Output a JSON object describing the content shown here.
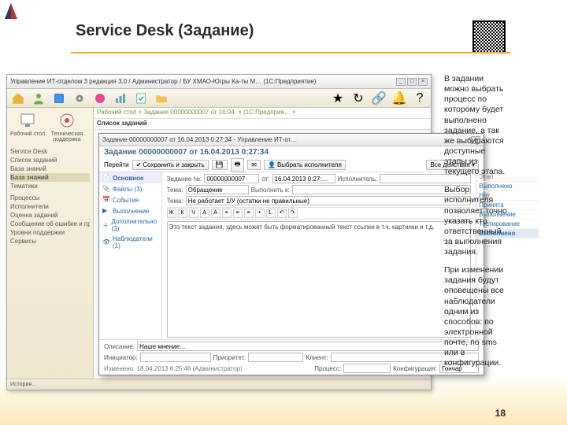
{
  "slide": {
    "title": "Service Desk (Задание)",
    "page_number": "18"
  },
  "right_text": {
    "p1": "В задании можно выбрать процесс по которому будет выполнено задание, а так же выбираются доступные этапы из текущего этапа.",
    "p2": "Выбор исполнителя позволяет точно указать кто ответственный за выполнения задания.",
    "p3": "При изменении задания будут оповещены все наблюдатели одним из способов: по электронной почте, по sms или в конфигурации."
  },
  "app": {
    "window_title": "Управление ИТ-отделом 3 редакция 3.0 / Администратор / БУ ХМАО-Югры Ка-ты М… (1С:Предприятие)",
    "statusbar_left": "История…",
    "sidebar": {
      "big": [
        {
          "label": "Рабочий стол"
        },
        {
          "label": "Техническая поддержка"
        }
      ],
      "items": [
        "Service Desk",
        "Список заданий",
        "База знаний",
        "База знаний",
        "Тематики",
        "Процессы",
        "Исполнители",
        "Оценка заданий",
        "Сообщение об ошибке и пр…",
        "Уровни поддержки",
        "Сервисы"
      ],
      "selected_index": 3
    },
    "main": {
      "breadcrumb": "Рабочий стол  ×  Задание 00000000007 от 16.04.  ×  (1С:Предприя…  ×",
      "list_title": "Список заданий"
    }
  },
  "task": {
    "window_title": "Задание 00000000007 от 16.04.2013 0:27:34 - Управление ИТ-от…",
    "header": "Задание 00000000007 от 16.04.2013 0:27:34",
    "toolbar": {
      "go": "Перейти",
      "save_close": "Сохранить и закрыть",
      "save_icon": "💾",
      "assign": "Выбрать исполнителя",
      "all_actions": "Все действия ▾"
    },
    "tabs": [
      {
        "label": "Основное",
        "icon": "doc"
      },
      {
        "label": "Файлы (3)",
        "icon": "clip"
      },
      {
        "label": "События",
        "icon": "cal"
      },
      {
        "label": "Выполнение",
        "icon": "run"
      },
      {
        "label": "Дополнительно (3)",
        "icon": "plus"
      },
      {
        "label": "Наблюдатели (1)",
        "icon": "eye"
      }
    ],
    "selected_tab": 0,
    "fields": {
      "number_label": "Задание №:",
      "number": "00000000007",
      "date_label": "от:",
      "date": "16.04.2013 0:27:…",
      "executor_label": "Исполнитель:",
      "executor": "",
      "theme_label": "Тема:",
      "theme": "Обращение",
      "process_label": "Выполнить к:",
      "process": "",
      "subject_label": "Тема:",
      "subject": "Не работает 1/У (остатки не правильные)"
    },
    "rte": {
      "format_btns": [
        "Ж",
        "К",
        "Ч",
        "A",
        "A",
        "≡",
        "≡",
        "≡",
        "•",
        "1.",
        "↶",
        "↷"
      ],
      "body_html": "Это текст задания, здесь может быть форматированный текст ссылки в т.ч. картинки и т.д."
    },
    "right_panel": {
      "header": "Этап",
      "stages": [
        "Выполнено",
        "Нет",
        "Принята",
        "Выполнение",
        "Тестирование",
        "Выполнено"
      ],
      "selected": 5
    },
    "bottom": {
      "description_label": "Описание:",
      "description": "Наше мнение…",
      "initiator_label": "Инициатор:",
      "initiator": "",
      "priority_label": "Приоритет:",
      "priority": "",
      "client_label": "Клиент:",
      "client": "",
      "last_edit": "Изменено: 18.04.2013 6:25:46 (Администратор)",
      "process_field_label": "Процесс:",
      "process_field": "",
      "cfg_label": "Конфигурация:",
      "cfg": "Гончар"
    }
  }
}
